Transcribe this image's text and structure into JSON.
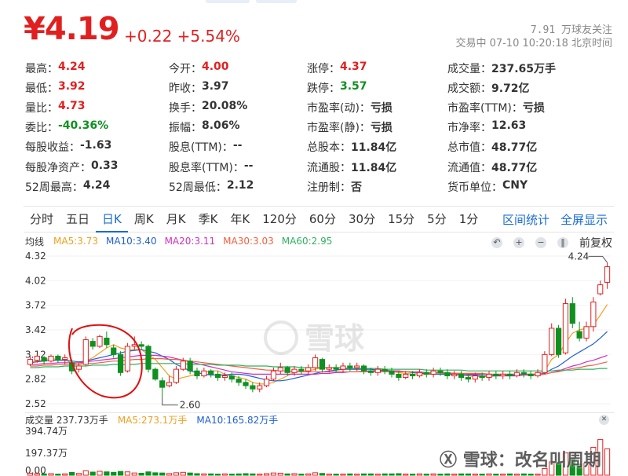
{
  "quote": {
    "price": "¥4.19",
    "change": "+0.22 +5.54%",
    "followers": "7.91 万球友关注",
    "status": "交易中 07-10 10:20:18 北京时间"
  },
  "stats": [
    [
      [
        "最高：",
        "4.24",
        "red"
      ],
      [
        "今开：",
        "4.00",
        "red"
      ],
      [
        "涨停：",
        "4.37",
        "red"
      ],
      [
        "成交量：",
        "237.65万手",
        ""
      ]
    ],
    [
      [
        "最低：",
        "3.92",
        "red"
      ],
      [
        "昨收：",
        "3.97",
        ""
      ],
      [
        "跌停：",
        "3.57",
        "green"
      ],
      [
        "成交额：",
        "9.72亿",
        ""
      ]
    ],
    [
      [
        "量比：",
        "4.73",
        "red"
      ],
      [
        "换手：",
        "20.08%",
        ""
      ],
      [
        "市盈率(动)：",
        "亏损",
        ""
      ],
      [
        "市盈率(TTM)：",
        "亏损",
        ""
      ]
    ],
    [
      [
        "委比：",
        "-40.36%",
        "green"
      ],
      [
        "振幅：",
        "8.06%",
        ""
      ],
      [
        "市盈率(静)：",
        "亏损",
        ""
      ],
      [
        "市净率：",
        "12.63",
        ""
      ]
    ],
    [
      [
        "每股收益：",
        "-1.63",
        ""
      ],
      [
        "股息(TTM)：",
        "--",
        ""
      ],
      [
        "总股本：",
        "11.84亿",
        ""
      ],
      [
        "总市值：",
        "48.77亿",
        ""
      ]
    ],
    [
      [
        "每股净资产：",
        "0.33",
        ""
      ],
      [
        "股息率(TTM)：",
        "--",
        ""
      ],
      [
        "流通股：",
        "11.84亿",
        ""
      ],
      [
        "流通值：",
        "48.77亿",
        ""
      ]
    ],
    [
      [
        "52周最高：",
        "4.24",
        ""
      ],
      [
        "52周最低：",
        "2.12",
        ""
      ],
      [
        "注册制：",
        "否",
        ""
      ],
      [
        "货币单位：",
        "CNY",
        ""
      ]
    ]
  ],
  "tabs": [
    "分时",
    "五日",
    "日K",
    "周K",
    "月K",
    "季K",
    "年K",
    "120分",
    "60分",
    "30分",
    "15分",
    "5分",
    "1分"
  ],
  "active_tab": "日K",
  "tab_links": [
    "区间统计",
    "全屏显示"
  ],
  "ma": {
    "label": "均线",
    "items": [
      {
        "text": "MA5:3.73",
        "color": "#f0a020"
      },
      {
        "text": "MA10:3.40",
        "color": "#2060d0"
      },
      {
        "text": "MA20:3.11",
        "color": "#d030c0"
      },
      {
        "text": "MA30:3.03",
        "color": "#f06040"
      },
      {
        "text": "MA60:2.95",
        "color": "#30b060"
      }
    ]
  },
  "tools": {
    "back": "↶",
    "zoom_in": "+",
    "zoom_out": "−",
    "pause": "‖",
    "adjust": "前复权"
  },
  "colors": {
    "up": "#e02020",
    "down": "#109020",
    "accent": "#1a6bd0"
  },
  "chart_data": {
    "type": "candlestick",
    "ylim": [
      2.52,
      4.32
    ],
    "y_ticks": [
      "4.32",
      "4.02",
      "3.72",
      "3.42",
      "3.12",
      "2.82",
      "2.52"
    ],
    "max_label": "4.24",
    "min_label": "2.60",
    "candles": [
      [
        3.0,
        3.06,
        2.98,
        3.1
      ],
      [
        3.05,
        3.1,
        3.02,
        3.12
      ],
      [
        3.08,
        3.04,
        3.0,
        3.1
      ],
      [
        3.04,
        3.1,
        3.02,
        3.12
      ],
      [
        3.1,
        3.06,
        3.02,
        3.12
      ],
      [
        3.06,
        3.08,
        3.0,
        3.12
      ],
      [
        3.02,
        2.92,
        2.88,
        3.06
      ],
      [
        2.94,
        2.98,
        2.9,
        3.02
      ],
      [
        3.0,
        3.3,
        2.98,
        3.34
      ],
      [
        3.28,
        3.22,
        3.18,
        3.32
      ],
      [
        3.22,
        3.34,
        3.2,
        3.36
      ],
      [
        3.32,
        3.24,
        3.2,
        3.4
      ],
      [
        3.2,
        3.12,
        3.08,
        3.24
      ],
      [
        3.12,
        2.9,
        2.86,
        3.16
      ],
      [
        2.92,
        3.22,
        2.9,
        3.26
      ],
      [
        3.22,
        3.24,
        3.18,
        3.34
      ],
      [
        3.24,
        3.22,
        3.18,
        3.28
      ],
      [
        3.22,
        2.94,
        2.9,
        3.24
      ],
      [
        2.94,
        2.82,
        2.8,
        2.96
      ],
      [
        2.8,
        2.72,
        2.6,
        2.84
      ],
      [
        2.74,
        2.78,
        2.72,
        2.86
      ],
      [
        2.78,
        2.94,
        2.76,
        2.98
      ],
      [
        2.94,
        3.04,
        2.92,
        3.08
      ],
      [
        3.04,
        2.92,
        2.88,
        3.08
      ],
      [
        2.92,
        2.86,
        2.82,
        2.96
      ],
      [
        2.86,
        2.92,
        2.84,
        2.96
      ],
      [
        2.92,
        2.88,
        2.84,
        2.94
      ],
      [
        2.88,
        2.84,
        2.8,
        2.92
      ],
      [
        2.84,
        2.86,
        2.8,
        2.9
      ],
      [
        2.86,
        2.82,
        2.78,
        2.9
      ],
      [
        2.82,
        2.78,
        2.74,
        2.86
      ],
      [
        2.78,
        2.74,
        2.7,
        2.82
      ],
      [
        2.74,
        2.7,
        2.66,
        2.78
      ],
      [
        2.7,
        2.74,
        2.66,
        2.78
      ],
      [
        2.74,
        2.82,
        2.72,
        2.86
      ],
      [
        2.82,
        2.92,
        2.8,
        2.96
      ],
      [
        2.92,
        2.96,
        2.88,
        3.02
      ],
      [
        2.96,
        2.9,
        2.86,
        2.98
      ],
      [
        2.9,
        2.94,
        2.86,
        2.98
      ],
      [
        2.94,
        2.92,
        2.88,
        2.98
      ],
      [
        2.92,
        2.96,
        2.88,
        3.0
      ],
      [
        2.96,
        3.08,
        2.92,
        3.12
      ],
      [
        3.06,
        2.94,
        2.9,
        3.08
      ],
      [
        2.94,
        2.96,
        2.9,
        3.0
      ],
      [
        2.96,
        2.94,
        2.9,
        3.0
      ],
      [
        2.94,
        2.98,
        2.9,
        3.02
      ],
      [
        2.98,
        2.96,
        2.92,
        3.02
      ],
      [
        2.96,
        2.98,
        2.92,
        3.02
      ],
      [
        2.98,
        2.92,
        2.88,
        3.0
      ],
      [
        2.92,
        2.9,
        2.86,
        2.96
      ],
      [
        2.9,
        2.94,
        2.86,
        2.98
      ],
      [
        2.94,
        2.92,
        2.88,
        2.98
      ],
      [
        2.92,
        2.88,
        2.84,
        2.96
      ],
      [
        2.88,
        2.84,
        2.8,
        2.92
      ],
      [
        2.84,
        2.88,
        2.82,
        2.92
      ],
      [
        2.88,
        2.86,
        2.82,
        2.92
      ],
      [
        2.86,
        2.9,
        2.84,
        2.94
      ],
      [
        2.9,
        2.88,
        2.84,
        2.94
      ],
      [
        2.88,
        2.92,
        2.84,
        2.96
      ],
      [
        2.92,
        2.9,
        2.86,
        2.96
      ],
      [
        2.9,
        2.86,
        2.82,
        2.94
      ],
      [
        2.86,
        2.88,
        2.82,
        2.92
      ],
      [
        2.88,
        2.84,
        2.8,
        2.92
      ],
      [
        2.84,
        2.82,
        2.78,
        2.88
      ],
      [
        2.82,
        2.86,
        2.78,
        2.9
      ],
      [
        2.86,
        2.84,
        2.8,
        2.9
      ],
      [
        2.84,
        2.88,
        2.8,
        2.92
      ],
      [
        2.88,
        2.86,
        2.82,
        2.92
      ],
      [
        2.86,
        2.88,
        2.82,
        2.92
      ],
      [
        2.88,
        2.86,
        2.82,
        2.92
      ],
      [
        2.86,
        2.9,
        2.84,
        2.94
      ],
      [
        2.9,
        2.88,
        2.84,
        2.94
      ],
      [
        2.88,
        2.86,
        2.82,
        2.92
      ],
      [
        2.86,
        2.9,
        2.84,
        2.94
      ],
      [
        2.9,
        3.12,
        2.88,
        3.16
      ],
      [
        3.12,
        3.44,
        3.1,
        3.5
      ],
      [
        3.44,
        3.12,
        3.08,
        3.48
      ],
      [
        3.14,
        3.74,
        3.12,
        3.8
      ],
      [
        3.74,
        3.5,
        3.44,
        3.82
      ],
      [
        3.4,
        3.32,
        3.28,
        3.52
      ],
      [
        3.32,
        3.46,
        3.28,
        3.52
      ],
      [
        3.46,
        3.76,
        3.4,
        3.82
      ],
      [
        3.86,
        3.97,
        3.84,
        4.02
      ],
      [
        4.0,
        4.19,
        3.92,
        4.24
      ]
    ],
    "ma_values": {
      "MA5": [
        3.03,
        3.04,
        3.06,
        3.07,
        3.06,
        3.05,
        3.02,
        3.0,
        3.04,
        3.08,
        3.14,
        3.2,
        3.24,
        3.2,
        3.18,
        3.18,
        3.18,
        3.12,
        3.06,
        2.96,
        2.86,
        2.82,
        2.84,
        2.86,
        2.88,
        2.9,
        2.92,
        2.92,
        2.88,
        2.86,
        2.84,
        2.82,
        2.78,
        2.76,
        2.76,
        2.78,
        2.82,
        2.86,
        2.9,
        2.92,
        2.92,
        2.94,
        2.96,
        2.96,
        2.96,
        2.96,
        2.95,
        2.95,
        2.95,
        2.94,
        2.93,
        2.92,
        2.91,
        2.9,
        2.89,
        2.88,
        2.87,
        2.88,
        2.88,
        2.89,
        2.89,
        2.88,
        2.87,
        2.86,
        2.85,
        2.85,
        2.85,
        2.86,
        2.86,
        2.87,
        2.87,
        2.88,
        2.88,
        2.88,
        2.92,
        3.06,
        3.12,
        3.26,
        3.38,
        3.42,
        3.44,
        3.48,
        3.6,
        3.73
      ],
      "MA10": [
        3.02,
        3.03,
        3.04,
        3.05,
        3.05,
        3.05,
        3.04,
        3.03,
        3.04,
        3.06,
        3.08,
        3.1,
        3.12,
        3.14,
        3.16,
        3.17,
        3.18,
        3.16,
        3.14,
        3.1,
        3.06,
        3.0,
        2.96,
        2.92,
        2.9,
        2.88,
        2.87,
        2.87,
        2.87,
        2.88,
        2.88,
        2.87,
        2.85,
        2.83,
        2.81,
        2.8,
        2.8,
        2.81,
        2.83,
        2.85,
        2.87,
        2.89,
        2.91,
        2.92,
        2.93,
        2.94,
        2.94,
        2.94,
        2.94,
        2.94,
        2.93,
        2.93,
        2.92,
        2.92,
        2.91,
        2.9,
        2.89,
        2.89,
        2.88,
        2.88,
        2.88,
        2.88,
        2.87,
        2.87,
        2.87,
        2.86,
        2.86,
        2.86,
        2.86,
        2.86,
        2.86,
        2.87,
        2.87,
        2.88,
        2.89,
        2.94,
        2.98,
        3.04,
        3.1,
        3.15,
        3.2,
        3.25,
        3.32,
        3.4
      ],
      "MA20": [
        3.0,
        3.0,
        3.01,
        3.01,
        3.02,
        3.02,
        3.02,
        3.02,
        3.03,
        3.04,
        3.05,
        3.06,
        3.07,
        3.08,
        3.09,
        3.1,
        3.11,
        3.11,
        3.11,
        3.1,
        3.09,
        3.07,
        3.05,
        3.03,
        3.01,
        2.99,
        2.97,
        2.95,
        2.93,
        2.91,
        2.9,
        2.89,
        2.88,
        2.88,
        2.88,
        2.88,
        2.88,
        2.88,
        2.88,
        2.88,
        2.88,
        2.88,
        2.89,
        2.89,
        2.9,
        2.9,
        2.91,
        2.91,
        2.92,
        2.92,
        2.92,
        2.92,
        2.92,
        2.92,
        2.91,
        2.91,
        2.91,
        2.9,
        2.9,
        2.9,
        2.89,
        2.89,
        2.89,
        2.88,
        2.88,
        2.88,
        2.88,
        2.87,
        2.87,
        2.87,
        2.87,
        2.87,
        2.87,
        2.87,
        2.88,
        2.9,
        2.92,
        2.95,
        2.98,
        3.0,
        3.03,
        3.05,
        3.08,
        3.11
      ],
      "MA30": [
        2.98,
        2.98,
        2.99,
        2.99,
        3.0,
        3.0,
        3.0,
        3.0,
        3.01,
        3.01,
        3.02,
        3.03,
        3.04,
        3.04,
        3.05,
        3.06,
        3.06,
        3.07,
        3.07,
        3.07,
        3.06,
        3.06,
        3.05,
        3.04,
        3.03,
        3.02,
        3.01,
        3.0,
        2.99,
        2.98,
        2.97,
        2.96,
        2.95,
        2.94,
        2.93,
        2.93,
        2.92,
        2.92,
        2.91,
        2.91,
        2.91,
        2.91,
        2.91,
        2.91,
        2.91,
        2.91,
        2.91,
        2.91,
        2.91,
        2.91,
        2.91,
        2.91,
        2.91,
        2.91,
        2.91,
        2.91,
        2.9,
        2.9,
        2.9,
        2.9,
        2.9,
        2.89,
        2.89,
        2.89,
        2.89,
        2.89,
        2.88,
        2.88,
        2.88,
        2.88,
        2.88,
        2.88,
        2.88,
        2.88,
        2.88,
        2.9,
        2.91,
        2.93,
        2.95,
        2.96,
        2.98,
        2.99,
        3.01,
        3.03
      ],
      "MA60": [
        2.96,
        2.96,
        2.97,
        2.97,
        2.97,
        2.98,
        2.98,
        2.98,
        2.98,
        2.99,
        2.99,
        2.99,
        3.0,
        3.0,
        3.0,
        3.0,
        3.01,
        3.01,
        3.01,
        3.01,
        3.01,
        3.01,
        3.01,
        3.0,
        3.0,
        3.0,
        3.0,
        2.99,
        2.99,
        2.99,
        2.99,
        2.98,
        2.98,
        2.98,
        2.98,
        2.97,
        2.97,
        2.97,
        2.97,
        2.96,
        2.96,
        2.96,
        2.96,
        2.96,
        2.96,
        2.95,
        2.95,
        2.95,
        2.95,
        2.95,
        2.95,
        2.94,
        2.94,
        2.94,
        2.94,
        2.94,
        2.94,
        2.93,
        2.93,
        2.93,
        2.93,
        2.93,
        2.93,
        2.92,
        2.92,
        2.92,
        2.92,
        2.92,
        2.92,
        2.92,
        2.92,
        2.92,
        2.92,
        2.92,
        2.92,
        2.92,
        2.93,
        2.93,
        2.93,
        2.94,
        2.94,
        2.94,
        2.95,
        2.95
      ]
    },
    "volume": {
      "label": "成交量 237.73万手",
      "ma5": "MA5:273.1万手",
      "ma10": "MA10:165.82万手",
      "y_ticks": [
        "394.74万",
        "197.37万",
        "0.00"
      ],
      "ylim": [
        0,
        394.74
      ],
      "values": [
        18,
        15,
        12,
        14,
        10,
        12,
        25,
        16,
        40,
        28,
        35,
        30,
        26,
        34,
        30,
        20,
        18,
        30,
        22,
        20,
        15,
        22,
        26,
        20,
        14,
        12,
        12,
        10,
        12,
        10,
        12,
        14,
        12,
        10,
        14,
        20,
        18,
        12,
        14,
        10,
        12,
        22,
        16,
        10,
        10,
        10,
        12,
        10,
        12,
        12,
        10,
        12,
        12,
        14,
        10,
        10,
        12,
        10,
        12,
        10,
        12,
        10,
        12,
        12,
        10,
        10,
        12,
        10,
        10,
        12,
        10,
        12,
        10,
        10,
        60,
        120,
        110,
        200,
        150,
        100,
        110,
        250,
        320,
        237
      ]
    }
  },
  "watermarks": {
    "center": "雪球",
    "bottom": "雪球：改名叫周期"
  }
}
